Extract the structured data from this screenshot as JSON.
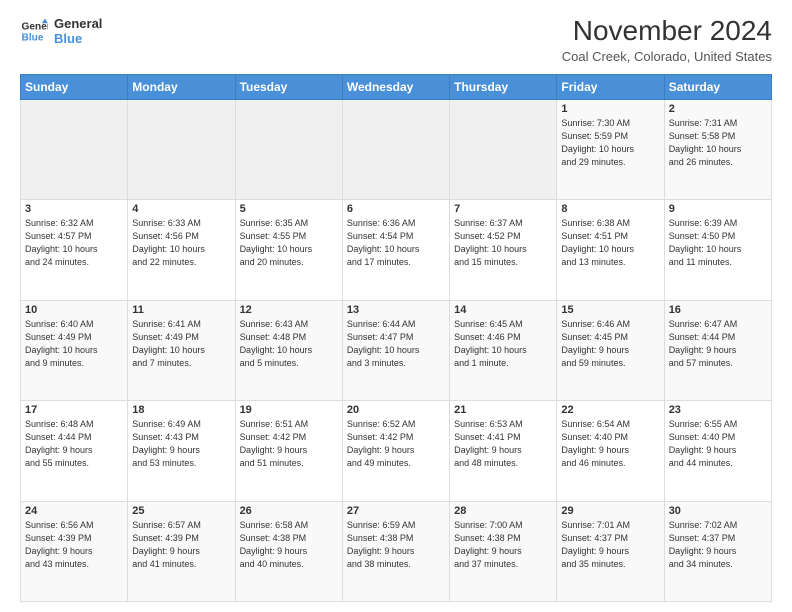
{
  "logo": {
    "line1": "General",
    "line2": "Blue"
  },
  "title": "November 2024",
  "subtitle": "Coal Creek, Colorado, United States",
  "days_of_week": [
    "Sunday",
    "Monday",
    "Tuesday",
    "Wednesday",
    "Thursday",
    "Friday",
    "Saturday"
  ],
  "weeks": [
    [
      {
        "day": "",
        "info": ""
      },
      {
        "day": "",
        "info": ""
      },
      {
        "day": "",
        "info": ""
      },
      {
        "day": "",
        "info": ""
      },
      {
        "day": "",
        "info": ""
      },
      {
        "day": "1",
        "info": "Sunrise: 7:30 AM\nSunset: 5:59 PM\nDaylight: 10 hours\nand 29 minutes."
      },
      {
        "day": "2",
        "info": "Sunrise: 7:31 AM\nSunset: 5:58 PM\nDaylight: 10 hours\nand 26 minutes."
      }
    ],
    [
      {
        "day": "3",
        "info": "Sunrise: 6:32 AM\nSunset: 4:57 PM\nDaylight: 10 hours\nand 24 minutes."
      },
      {
        "day": "4",
        "info": "Sunrise: 6:33 AM\nSunset: 4:56 PM\nDaylight: 10 hours\nand 22 minutes."
      },
      {
        "day": "5",
        "info": "Sunrise: 6:35 AM\nSunset: 4:55 PM\nDaylight: 10 hours\nand 20 minutes."
      },
      {
        "day": "6",
        "info": "Sunrise: 6:36 AM\nSunset: 4:54 PM\nDaylight: 10 hours\nand 17 minutes."
      },
      {
        "day": "7",
        "info": "Sunrise: 6:37 AM\nSunset: 4:52 PM\nDaylight: 10 hours\nand 15 minutes."
      },
      {
        "day": "8",
        "info": "Sunrise: 6:38 AM\nSunset: 4:51 PM\nDaylight: 10 hours\nand 13 minutes."
      },
      {
        "day": "9",
        "info": "Sunrise: 6:39 AM\nSunset: 4:50 PM\nDaylight: 10 hours\nand 11 minutes."
      }
    ],
    [
      {
        "day": "10",
        "info": "Sunrise: 6:40 AM\nSunset: 4:49 PM\nDaylight: 10 hours\nand 9 minutes."
      },
      {
        "day": "11",
        "info": "Sunrise: 6:41 AM\nSunset: 4:49 PM\nDaylight: 10 hours\nand 7 minutes."
      },
      {
        "day": "12",
        "info": "Sunrise: 6:43 AM\nSunset: 4:48 PM\nDaylight: 10 hours\nand 5 minutes."
      },
      {
        "day": "13",
        "info": "Sunrise: 6:44 AM\nSunset: 4:47 PM\nDaylight: 10 hours\nand 3 minutes."
      },
      {
        "day": "14",
        "info": "Sunrise: 6:45 AM\nSunset: 4:46 PM\nDaylight: 10 hours\nand 1 minute."
      },
      {
        "day": "15",
        "info": "Sunrise: 6:46 AM\nSunset: 4:45 PM\nDaylight: 9 hours\nand 59 minutes."
      },
      {
        "day": "16",
        "info": "Sunrise: 6:47 AM\nSunset: 4:44 PM\nDaylight: 9 hours\nand 57 minutes."
      }
    ],
    [
      {
        "day": "17",
        "info": "Sunrise: 6:48 AM\nSunset: 4:44 PM\nDaylight: 9 hours\nand 55 minutes."
      },
      {
        "day": "18",
        "info": "Sunrise: 6:49 AM\nSunset: 4:43 PM\nDaylight: 9 hours\nand 53 minutes."
      },
      {
        "day": "19",
        "info": "Sunrise: 6:51 AM\nSunset: 4:42 PM\nDaylight: 9 hours\nand 51 minutes."
      },
      {
        "day": "20",
        "info": "Sunrise: 6:52 AM\nSunset: 4:42 PM\nDaylight: 9 hours\nand 49 minutes."
      },
      {
        "day": "21",
        "info": "Sunrise: 6:53 AM\nSunset: 4:41 PM\nDaylight: 9 hours\nand 48 minutes."
      },
      {
        "day": "22",
        "info": "Sunrise: 6:54 AM\nSunset: 4:40 PM\nDaylight: 9 hours\nand 46 minutes."
      },
      {
        "day": "23",
        "info": "Sunrise: 6:55 AM\nSunset: 4:40 PM\nDaylight: 9 hours\nand 44 minutes."
      }
    ],
    [
      {
        "day": "24",
        "info": "Sunrise: 6:56 AM\nSunset: 4:39 PM\nDaylight: 9 hours\nand 43 minutes."
      },
      {
        "day": "25",
        "info": "Sunrise: 6:57 AM\nSunset: 4:39 PM\nDaylight: 9 hours\nand 41 minutes."
      },
      {
        "day": "26",
        "info": "Sunrise: 6:58 AM\nSunset: 4:38 PM\nDaylight: 9 hours\nand 40 minutes."
      },
      {
        "day": "27",
        "info": "Sunrise: 6:59 AM\nSunset: 4:38 PM\nDaylight: 9 hours\nand 38 minutes."
      },
      {
        "day": "28",
        "info": "Sunrise: 7:00 AM\nSunset: 4:38 PM\nDaylight: 9 hours\nand 37 minutes."
      },
      {
        "day": "29",
        "info": "Sunrise: 7:01 AM\nSunset: 4:37 PM\nDaylight: 9 hours\nand 35 minutes."
      },
      {
        "day": "30",
        "info": "Sunrise: 7:02 AM\nSunset: 4:37 PM\nDaylight: 9 hours\nand 34 minutes."
      }
    ]
  ]
}
